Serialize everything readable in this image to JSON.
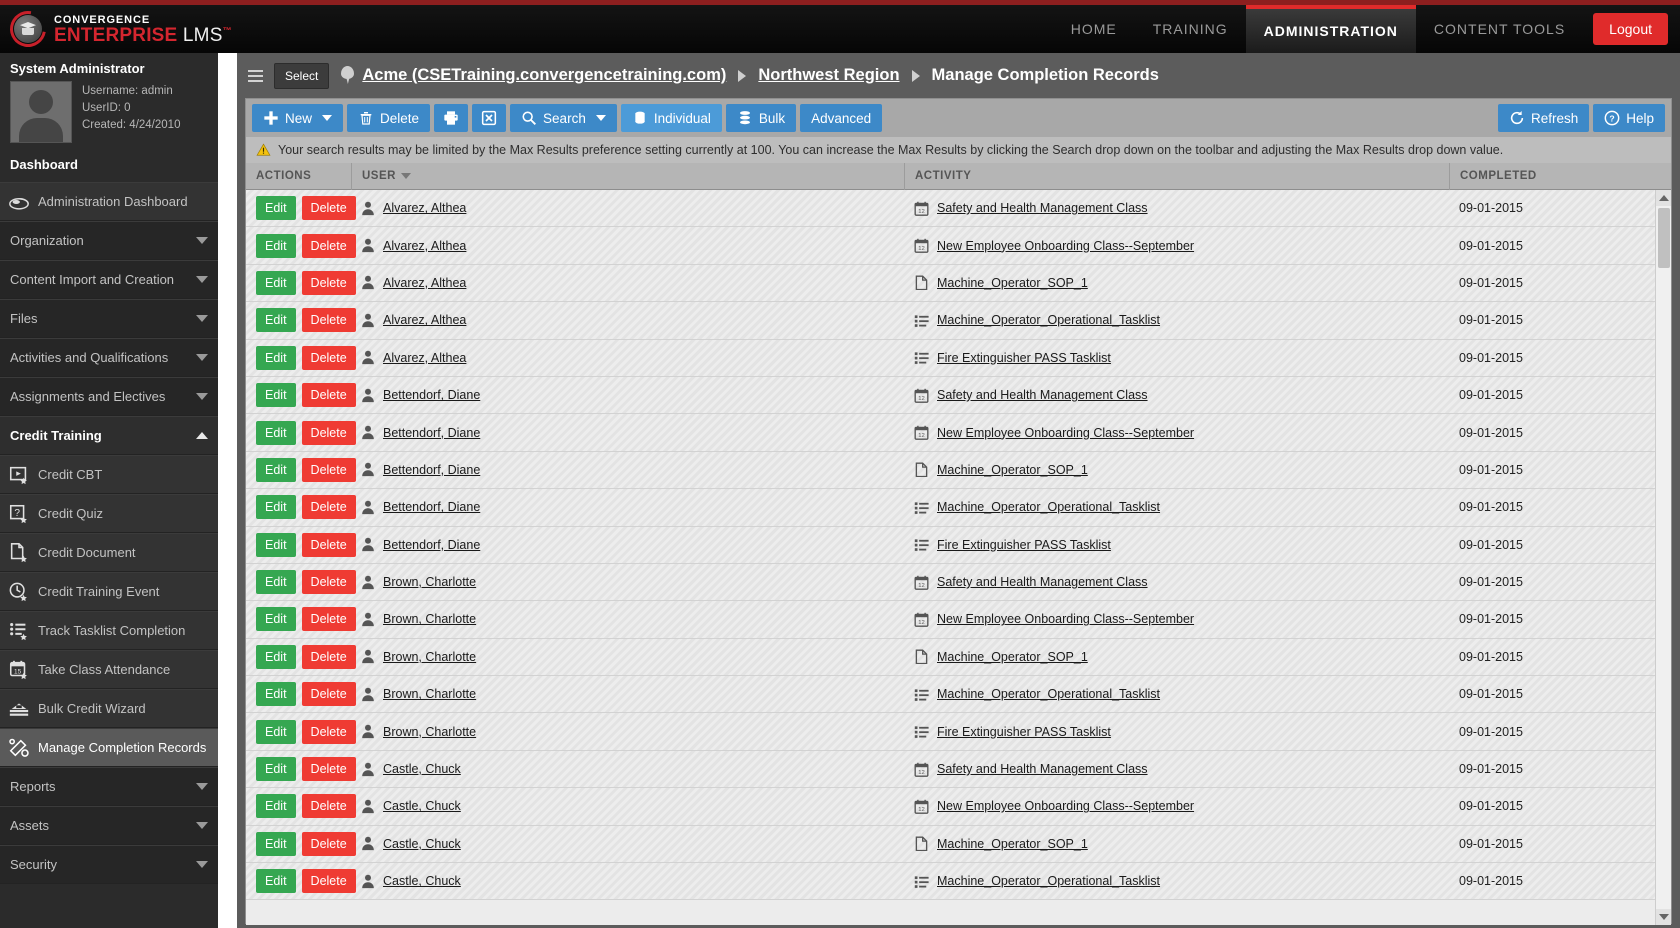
{
  "brand": {
    "line1": "CONVERGENCE",
    "line2_bold": "ENTERPRISE",
    "line2_light": "LMS",
    "tm": "™",
    "accent": "#d4262f"
  },
  "topnav": {
    "items": [
      {
        "label": "HOME",
        "active": false
      },
      {
        "label": "TRAINING",
        "active": false
      },
      {
        "label": "ADMINISTRATION",
        "active": true
      },
      {
        "label": "CONTENT TOOLS",
        "active": false
      }
    ],
    "logout_label": "Logout"
  },
  "sidebar": {
    "user": {
      "name": "System Administrator",
      "username": "Username: admin",
      "userid": "UserID: 0",
      "created": "Created: 4/24/2010"
    },
    "dashboard_label": "Dashboard",
    "items": [
      {
        "label": "Administration Dashboard",
        "type": "link",
        "icon": "dashboard-icon"
      },
      {
        "label": "Organization",
        "type": "group",
        "state": "collapsed"
      },
      {
        "label": "Content Import and Creation",
        "type": "group",
        "state": "collapsed"
      },
      {
        "label": "Files",
        "type": "group",
        "state": "collapsed"
      },
      {
        "label": "Activities and Qualifications",
        "type": "group",
        "state": "collapsed"
      },
      {
        "label": "Assignments and Electives",
        "type": "group",
        "state": "collapsed"
      },
      {
        "label": "Credit Training",
        "type": "group",
        "state": "expanded"
      },
      {
        "label": "Credit CBT",
        "type": "child",
        "icon": "credit-cbt-icon"
      },
      {
        "label": "Credit Quiz",
        "type": "child",
        "icon": "credit-quiz-icon"
      },
      {
        "label": "Credit Document",
        "type": "child",
        "icon": "credit-document-icon"
      },
      {
        "label": "Credit Training Event",
        "type": "child",
        "icon": "credit-training-event-icon"
      },
      {
        "label": "Track Tasklist Completion",
        "type": "child",
        "icon": "track-tasklist-icon"
      },
      {
        "label": "Take Class Attendance",
        "type": "child",
        "icon": "take-class-attendance-icon"
      },
      {
        "label": "Bulk Credit Wizard",
        "type": "child",
        "icon": "bulk-credit-wizard-icon"
      },
      {
        "label": "Manage Completion Records",
        "type": "child",
        "icon": "manage-completion-icon",
        "selected": true
      },
      {
        "label": "Reports",
        "type": "group",
        "state": "collapsed"
      },
      {
        "label": "Assets",
        "type": "group",
        "state": "collapsed"
      },
      {
        "label": "Security",
        "type": "group",
        "state": "collapsed"
      }
    ]
  },
  "breadcrumb": {
    "select_label": "Select",
    "items": [
      {
        "label": "Acme (CSETraining.convergencetraining.com)",
        "link": true
      },
      {
        "label": "Northwest Region",
        "link": true
      },
      {
        "label": "Manage Completion Records",
        "link": false
      }
    ]
  },
  "toolbar": {
    "new_label": "New",
    "delete_label": "Delete",
    "print_label": "",
    "export_label": "",
    "search_label": "Search",
    "individual_label": "Individual",
    "bulk_label": "Bulk",
    "advanced_label": "Advanced",
    "refresh_label": "Refresh",
    "help_label": "Help"
  },
  "warning": {
    "text": "Your search results may be limited by the Max Results preference setting currently at 100. You can increase the Max Results by clicking the Search drop down on the toolbar and adjusting the Max Results drop down value.",
    "max_results": "100"
  },
  "grid": {
    "columns": [
      "ACTIONS",
      "USER",
      "ACTIVITY",
      "COMPLETED"
    ],
    "sorted_column": "USER",
    "edit_label": "Edit",
    "delete_label": "Delete",
    "rows": [
      {
        "user": "Alvarez, Althea",
        "activity": "Safety and Health Management Class",
        "activity_icon": "calendar-icon",
        "completed": "09-01-2015"
      },
      {
        "user": "Alvarez, Althea",
        "activity": "New Employee Onboarding Class--September",
        "activity_icon": "calendar-icon",
        "completed": "09-01-2015"
      },
      {
        "user": "Alvarez, Althea",
        "activity": "Machine_Operator_SOP_1",
        "activity_icon": "document-icon",
        "completed": "09-01-2015"
      },
      {
        "user": "Alvarez, Althea",
        "activity": "Machine_Operator_Operational_Tasklist",
        "activity_icon": "tasklist-icon",
        "completed": "09-01-2015"
      },
      {
        "user": "Alvarez, Althea",
        "activity": "Fire Extinguisher PASS Tasklist",
        "activity_icon": "tasklist-icon",
        "completed": "09-01-2015"
      },
      {
        "user": "Bettendorf, Diane",
        "activity": "Safety and Health Management Class",
        "activity_icon": "calendar-icon",
        "completed": "09-01-2015"
      },
      {
        "user": "Bettendorf, Diane",
        "activity": "New Employee Onboarding Class--September",
        "activity_icon": "calendar-icon",
        "completed": "09-01-2015"
      },
      {
        "user": "Bettendorf, Diane",
        "activity": "Machine_Operator_SOP_1",
        "activity_icon": "document-icon",
        "completed": "09-01-2015"
      },
      {
        "user": "Bettendorf, Diane",
        "activity": "Machine_Operator_Operational_Tasklist",
        "activity_icon": "tasklist-icon",
        "completed": "09-01-2015"
      },
      {
        "user": "Bettendorf, Diane",
        "activity": "Fire Extinguisher PASS Tasklist",
        "activity_icon": "tasklist-icon",
        "completed": "09-01-2015"
      },
      {
        "user": "Brown, Charlotte",
        "activity": "Safety and Health Management Class",
        "activity_icon": "calendar-icon",
        "completed": "09-01-2015"
      },
      {
        "user": "Brown, Charlotte",
        "activity": "New Employee Onboarding Class--September",
        "activity_icon": "calendar-icon",
        "completed": "09-01-2015"
      },
      {
        "user": "Brown, Charlotte",
        "activity": "Machine_Operator_SOP_1",
        "activity_icon": "document-icon",
        "completed": "09-01-2015"
      },
      {
        "user": "Brown, Charlotte",
        "activity": "Machine_Operator_Operational_Tasklist",
        "activity_icon": "tasklist-icon",
        "completed": "09-01-2015"
      },
      {
        "user": "Brown, Charlotte",
        "activity": "Fire Extinguisher PASS Tasklist",
        "activity_icon": "tasklist-icon",
        "completed": "09-01-2015"
      },
      {
        "user": "Castle, Chuck",
        "activity": "Safety and Health Management Class",
        "activity_icon": "calendar-icon",
        "completed": "09-01-2015"
      },
      {
        "user": "Castle, Chuck",
        "activity": "New Employee Onboarding Class--September",
        "activity_icon": "calendar-icon",
        "completed": "09-01-2015"
      },
      {
        "user": "Castle, Chuck",
        "activity": "Machine_Operator_SOP_1",
        "activity_icon": "document-icon",
        "completed": "09-01-2015"
      },
      {
        "user": "Castle, Chuck",
        "activity": "Machine_Operator_Operational_Tasklist",
        "activity_icon": "tasklist-icon",
        "completed": "09-01-2015"
      }
    ]
  }
}
